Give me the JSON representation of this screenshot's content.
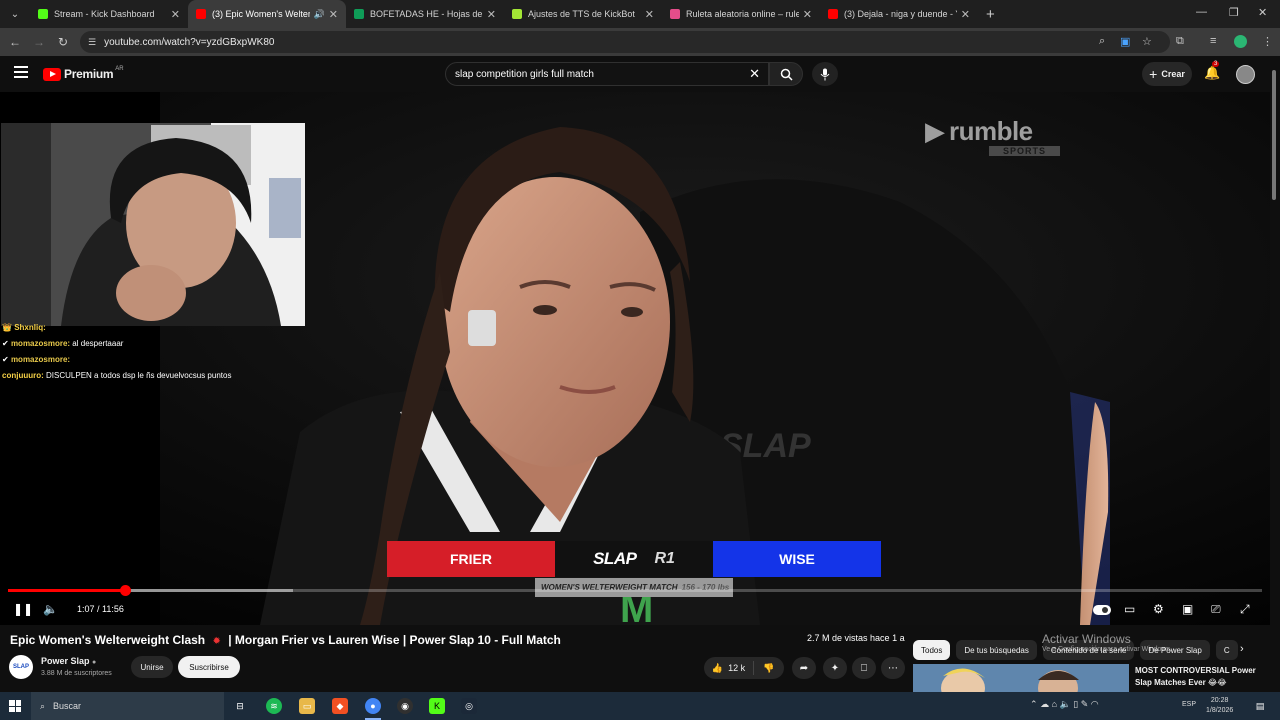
{
  "browser": {
    "tabs": [
      {
        "title": "Stream - Kick Dashboard",
        "favicon_color": "#53fc18",
        "active": false
      },
      {
        "title": "(3) Epic Women's Welterwe",
        "favicon_color": "#ff0000",
        "active": true
      },
      {
        "title": "BOFETADAS HE - Hojas de cálc",
        "favicon_color": "#0f9d58",
        "active": false
      },
      {
        "title": "Ajustes de TTS de KickBot",
        "favicon_color": "#a3e635",
        "active": false
      },
      {
        "title": "Ruleta aleatoria online – rulet",
        "favicon_color": "#e54d8a",
        "active": false
      },
      {
        "title": "(3) Dejala - niga y duende - You",
        "favicon_color": "#ff0000",
        "active": false
      }
    ],
    "url": "youtube.com/watch?v=yzdGBxpWK80"
  },
  "youtube": {
    "brand": "Premium",
    "brand_sup": "AR",
    "search_value": "slap competition girls full match",
    "create_label": "Crear",
    "notif_count": "3"
  },
  "video": {
    "watermark": "rumble",
    "watermark_sub": "SPORTS",
    "scoreboard": {
      "left_name": "FRIER",
      "center_logo": "SLAP",
      "round": "R1",
      "right_name": "WISE",
      "match_label": "WOMEN'S WELTERWEIGHT MATCH",
      "weight": "156 - 170 lbs"
    },
    "progress_fraction": 0.093,
    "buffered_fraction": 0.227,
    "time_current": "1:07",
    "time_total": "11:56"
  },
  "chat": [
    {
      "user": "Shxnliq:",
      "text": ""
    },
    {
      "user": "momazosmore:",
      "text": "al despertaaar"
    },
    {
      "user": "momazosmore:",
      "text": ""
    },
    {
      "user": "conjuuuro:",
      "text": "DISCULPEN a todos dsp le ñs devuelvocsus puntos"
    }
  ],
  "meta": {
    "title_part1": "Epic Women's Welterweight Clash",
    "title_part2": "| Morgan Frier vs Lauren Wise | Power Slap 10 - Full Match",
    "views": "2.7 M de vistas",
    "ago": "hace 1 a",
    "channel_name": "Power Slap",
    "channel_avatar_text": "SLAP",
    "subscribers": "3.88 M de suscriptores",
    "join_label": "Unirse",
    "subscribe_label": "Suscribirse",
    "likes": "12 k"
  },
  "chips": [
    "Todos",
    "De tus búsquedas",
    "Contenido de la serie",
    "De Power Slap",
    "C"
  ],
  "windows_activation": {
    "line1": "Activar Windows",
    "line2": "Ve a Configuración para activar Windows."
  },
  "recommended": {
    "title": "MOST CONTROVERSIAL Power Slap Matches Ever 😂😂"
  },
  "taskbar": {
    "search_placeholder": "Buscar",
    "lang": "ESP",
    "time": "20:28",
    "date": "1/8/2026"
  },
  "colors": {
    "accent": "#ff0000",
    "red_corner": "#d61e28",
    "blue_corner": "#1434e8"
  }
}
